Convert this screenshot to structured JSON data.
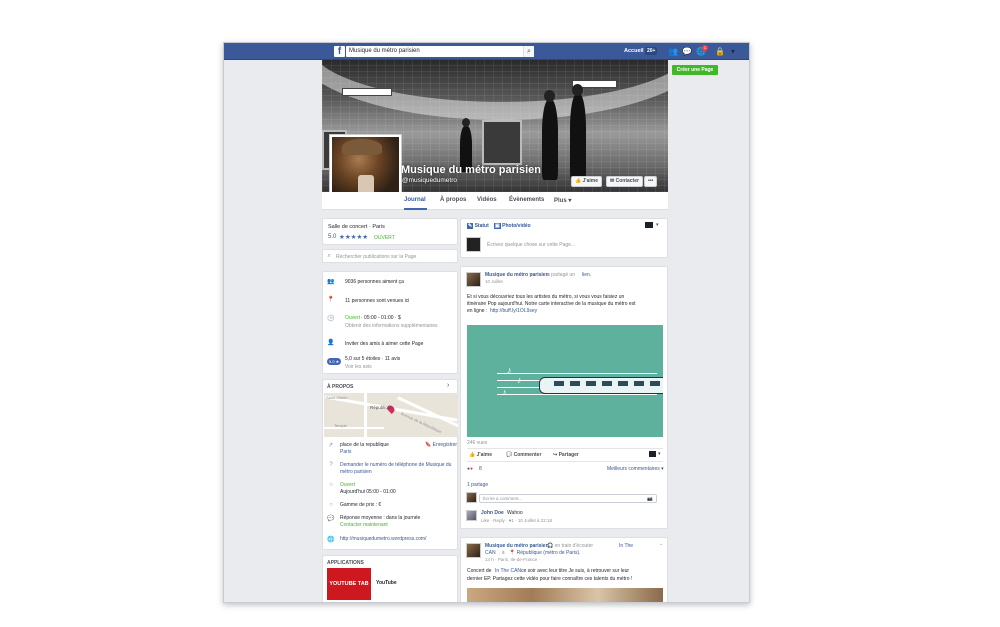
{
  "topbar": {
    "search_value": "Musique du métro parisien",
    "home_label": "Accueil",
    "home_count": "20+",
    "notif_count": "1"
  },
  "sidebar_right": {
    "create_page": "Créer une Page"
  },
  "cover": {
    "title": "Musique du métro parisien",
    "handle": "@musiquedumetro",
    "like_button": "J'aime",
    "contact_button": "Contacter",
    "more_button": "•••"
  },
  "tabs": [
    "Journal",
    "À propos",
    "Vidéos",
    "Évènements",
    "Plus ▾"
  ],
  "left": {
    "category": "Salle de concert · Paris",
    "rating": "5.0",
    "stars": "★★★★★",
    "open_status": "OUVERT",
    "search_placeholder": "Rechercher publications sur la Page",
    "stats": {
      "likes": "9036 personnes aiment ça",
      "visits": "11 personnes sont venues ici",
      "hours_open": "Ouvert",
      "hours_range": " · 05:00 - 01:00 · $",
      "more_info": "Obtenir des informations supplémentaires",
      "invite": "Inviter des amis à aimer cette Page",
      "rating_badge": "5.0 ★",
      "rating_text": "5,0 sur 5 étoiles · 11 avis",
      "see_reviews": "Voir les avis"
    },
    "about": {
      "title": "À PROPOS",
      "map_labels": [
        "Saint-Martin",
        "République",
        "Temple",
        "Avenue de la République"
      ],
      "address_line1": "place de la republique",
      "address_line2": "Paris",
      "save": "Enregistrer",
      "phone_request_1": "Demander le numéro de téléphone de Musique du",
      "phone_request_2": "métro parisien",
      "open_label": "Ouvert",
      "open_today": "Aujourd'hui 05:00 - 01:00",
      "price": "Gamme de prix : €",
      "response": "Réponse moyenne : dans la journée",
      "contact_now": "Contacter maintenant",
      "website": "http://musiquedumetro.wordpress.com/"
    },
    "apps": {
      "title": "APPLICATIONS",
      "thumb_label": "YOUTUBE TAB",
      "name": "YouTube"
    }
  },
  "composer": {
    "status": "Statut",
    "photo_video": "Photo/vidéo",
    "placeholder": "Écrivez quelque chose sur cette Page..."
  },
  "post1": {
    "author": "Musique du métro parisien",
    "action": " a partagé un ",
    "action_link": "lien.",
    "date": "10 Juillet",
    "text_line1": "Et si vous découvriez tous les artistes du métro, si vous vous faisiez un",
    "text_line2": "itinéraire Pop aujourd'hui. Notre carte interactive de la musique du métro est",
    "text_line3": "en ligne : ",
    "text_link": "http://buff.ly/1OL9sey",
    "views": "246 vues",
    "like": "J'aime",
    "comment": "Commenter",
    "share": "Partager",
    "reactions_count": "8",
    "top_comments": "Meilleurs commentaires ▾",
    "shares": "1 partage",
    "comment_placeholder": "Écrire a comment...",
    "commenter": "John Doe",
    "comment_text": "Wahoo",
    "comment_meta": "Like · Reply · ♥1 · 10 Juillet à 22:18"
  },
  "post2": {
    "author": "Musique du métro parisien",
    "activity": " 🎧 en train d'écouter ",
    "activity_link": "In The",
    "line2_link": "CAN",
    "line2_at": ". à ",
    "line2_place": "📍 République (métro de Paris).",
    "meta": "14 h · Paris, Ile-de-France · ",
    "text_line1_a": "Concert de ",
    "text_line1_link": "In The CAN",
    "text_line1_b": " ce soir avec leur titre Je suis, à retrouver sur leur",
    "text_line2": "dernier EP. Partagez cette vidéo pour faire connaître ces talents du métro !"
  }
}
